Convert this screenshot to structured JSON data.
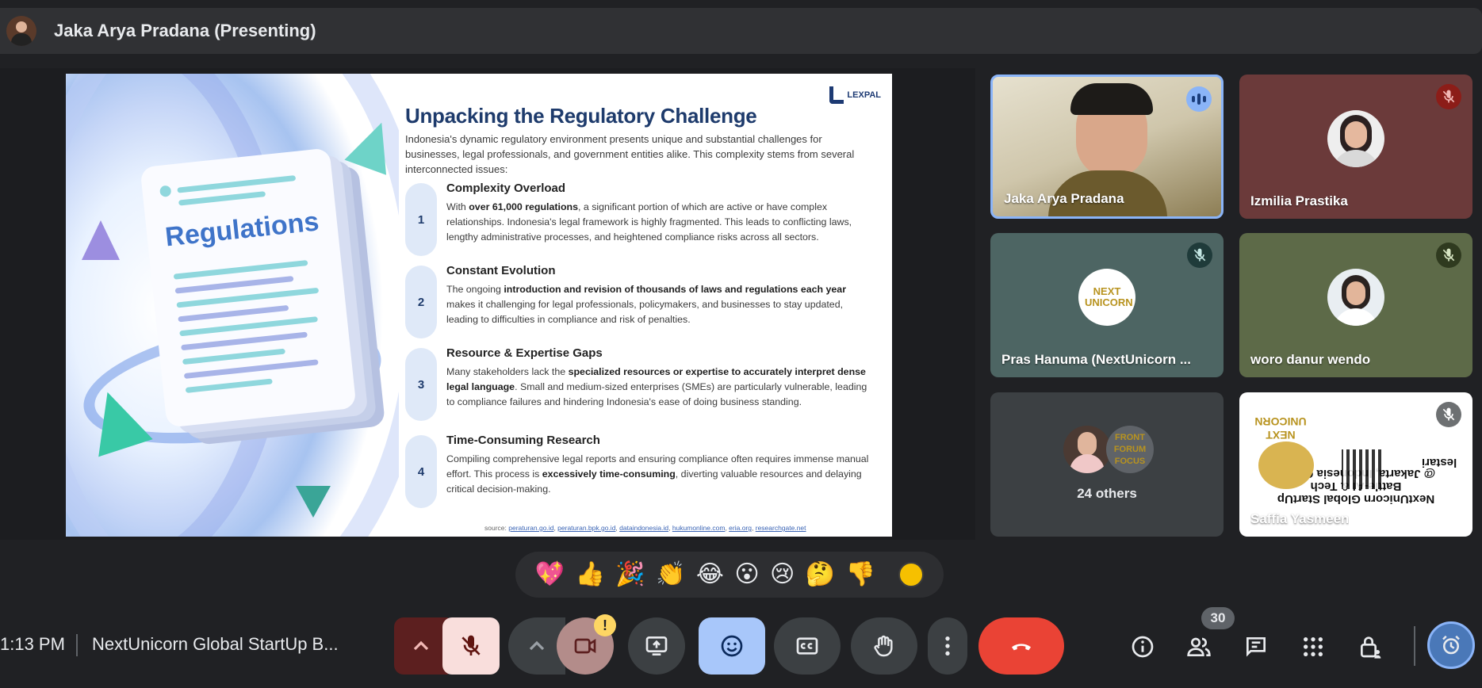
{
  "header": {
    "presenter_title": "Jaka Arya Pradana (Presenting)"
  },
  "slide": {
    "logo_text": "LEXPAL",
    "art_label": "Regulations",
    "title": "Unpacking the Regulatory Challenge",
    "intro": "Indonesia's dynamic regulatory environment presents unique and substantial challenges for businesses, legal professionals, and government entities alike. This complexity stems from several interconnected issues:",
    "items": [
      {
        "num": "1",
        "heading": "Complexity Overload",
        "pre": "With ",
        "bold": "over 61,000 regulations",
        "post": ", a significant portion of which are active or have complex relationships. Indonesia's legal framework is highly fragmented. This leads to conflicting laws, lengthy administrative processes, and heightened compliance risks across all sectors."
      },
      {
        "num": "2",
        "heading": "Constant Evolution",
        "pre": "The ongoing ",
        "bold": "introduction and revision of thousands of laws and regulations each year",
        "post": " makes it challenging for legal professionals, policymakers, and businesses to stay updated, leading to difficulties in compliance and risk of penalties."
      },
      {
        "num": "3",
        "heading": "Resource & Expertise Gaps",
        "pre": "Many stakeholders lack the ",
        "bold": "specialized resources or expertise to accurately interpret dense legal language",
        "post": ". Small and medium-sized enterprises (SMEs) are particularly vulnerable, leading to compliance failures and hindering Indonesia's ease of doing business standing."
      },
      {
        "num": "4",
        "heading": "Time-Consuming Research",
        "pre": "Compiling comprehensive legal reports and ensuring compliance often requires immense manual effort. This process is ",
        "bold": "excessively time-consuming",
        "post": ", diverting valuable resources and delaying critical decision-making."
      }
    ],
    "source_prefix": "source: ",
    "sources": [
      "peraturan.go.id",
      "peraturan.bpk.go.id",
      "dataindonesia.id",
      "hukumonline.com",
      "eria.org",
      "researchgate.net"
    ]
  },
  "participants": [
    {
      "name": "Jaka Arya Pradana",
      "state": "speaking"
    },
    {
      "name": "Izmilia Prastika",
      "state": "muted"
    },
    {
      "name": "Pras Hanuma (NextUnicorn ...",
      "state": "muted",
      "avatar_text": "NEXT UNICORN"
    },
    {
      "name": "woro danur wendo",
      "state": "muted"
    },
    {
      "name": "Saffia Yasmeen",
      "state": "muted"
    }
  ],
  "others": {
    "label": "24 others",
    "avatar_text": "FRONT FORUM FOCUS"
  },
  "poster": {
    "lines": [
      "NextUnicorn Global StartUp",
      "Battle-AI & Tech",
      "@ Jakarta, Indonesia Online"
    ],
    "side_text": "lestari",
    "brand": "NEXT UNICORN"
  },
  "reactions": [
    "💖",
    "👍",
    "🎉",
    "👏",
    "😂",
    "😮",
    "😢",
    "🤔",
    "👎"
  ],
  "bottom": {
    "time": "1:13 PM",
    "meeting_title": "NextUnicorn Global StartUp B...",
    "participant_count": "30",
    "cam_badge": "!"
  },
  "colors": {
    "end_call": "#ea4335",
    "active_blue": "#a8c7fa",
    "mic_off_bg": "#f9dedc",
    "speaking_border": "#8ab4f8"
  }
}
